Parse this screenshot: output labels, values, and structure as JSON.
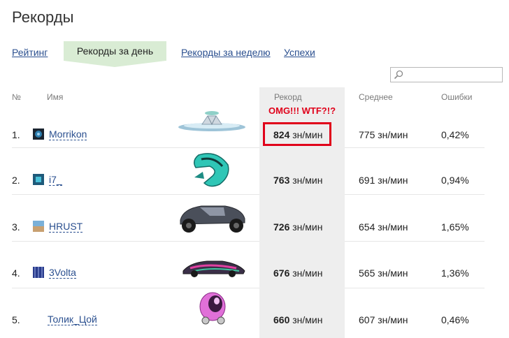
{
  "page": {
    "title": "Рекорды"
  },
  "tabs": [
    {
      "label": "Рейтинг",
      "active": false
    },
    {
      "label": "Рекорды за день",
      "active": true
    },
    {
      "label": "Рекорды за неделю",
      "active": false
    },
    {
      "label": "Успехи",
      "active": false
    }
  ],
  "search": {
    "value": "",
    "placeholder": ""
  },
  "table": {
    "headers": {
      "rank": "№",
      "name": "Имя",
      "record": "Рекорд",
      "average": "Среднее",
      "errors": "Ошибки"
    },
    "annotation": "OMG!!! WTF?!?",
    "unit": "зн/мин",
    "rows": [
      {
        "rank": "1.",
        "name": "Morrikon",
        "record": "824",
        "average": "775 зн/мин",
        "errors": "0,42%",
        "car": "saucer-car-icon"
      },
      {
        "rank": "2.",
        "name": "i7_",
        "record": "763",
        "average": "691 зн/мин",
        "errors": "0,94%",
        "car": "pod-car-icon"
      },
      {
        "rank": "3.",
        "name": "HRUST",
        "record": "726",
        "average": "654 зн/мин",
        "errors": "1,65%",
        "car": "buggy-car-icon"
      },
      {
        "rank": "4.",
        "name": "3Volta",
        "record": "676",
        "average": "565 зн/мин",
        "errors": "1,36%",
        "car": "concept-car-icon"
      },
      {
        "rank": "5.",
        "name": "Толик_Цой",
        "record": "660",
        "average": "607 зн/мин",
        "errors": "0,46%",
        "car": "egg-car-icon"
      }
    ]
  },
  "colors": {
    "link": "#2a4f8f",
    "active_tab": "#d9ecd4",
    "highlight": "#e0001a",
    "record_column": "#eeeeee"
  }
}
